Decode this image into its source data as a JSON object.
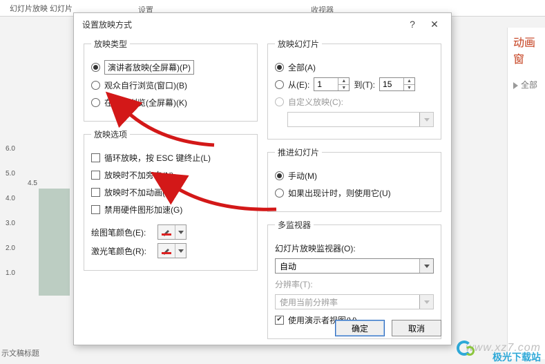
{
  "ribbon": {
    "group1": "幻灯片放映  幻灯片",
    "group2": "设置",
    "group3": "收视器"
  },
  "side": {
    "title": "动画窗",
    "play": "全部"
  },
  "footer": "示文稿标题",
  "watermark": "www.xz7.com",
  "brand": "极光下载站",
  "chart_data": {
    "type": "bar",
    "categories": [
      "4.5"
    ],
    "values": [
      4.5
    ],
    "ylim": [
      0,
      6
    ],
    "yticks": [
      1.0,
      2.0,
      3.0,
      4.0,
      5.0,
      6.0
    ],
    "series_label": "4.5"
  },
  "dialog": {
    "title": "设置放映方式",
    "help": "?",
    "close": "✕",
    "showType": {
      "legend": "放映类型",
      "opt1": "演讲者放映(全屏幕)(P)",
      "opt2": "观众自行浏览(窗口)(B)",
      "opt3": "在展台浏览(全屏幕)(K)"
    },
    "showOptions": {
      "legend": "放映选项",
      "c1": "循环放映，按 ESC 键终止(L)",
      "c2": "放映时不加旁白(N)",
      "c3": "放映时不加动画(S)",
      "c4": "禁用硬件图形加速(G)",
      "penLabel": "绘图笔颜色(E):",
      "laserLabel": "激光笔颜色(R):"
    },
    "slides": {
      "legend": "放映幻灯片",
      "all": "全部(A)",
      "fromLabel": "从(E):",
      "from": "1",
      "toLabel": "到(T):",
      "to": "15",
      "custom": "自定义放映(C):",
      "customValue": ""
    },
    "advance": {
      "legend": "推进幻灯片",
      "manual": "手动(M)",
      "timing": "如果出现计时，则使用它(U)"
    },
    "monitors": {
      "legend": "多监视器",
      "monLabel": "幻灯片放映监视器(O):",
      "monValue": "自动",
      "resLabel": "分辨率(T):",
      "resValue": "使用当前分辨率",
      "presenter": "使用演示者视图(V)"
    },
    "ok": "确定",
    "cancel": "取消"
  }
}
